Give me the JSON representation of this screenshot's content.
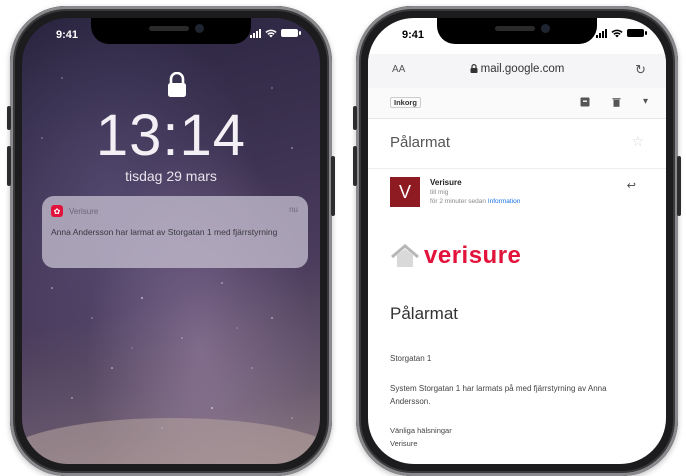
{
  "lock_phone": {
    "status_time": "9:41",
    "clock": "13:14",
    "date": "tisdag 29 mars",
    "notification": {
      "app_name": "Verisure",
      "time": "nu",
      "body": "Anna Andersson har larmat av Storgatan 1 med fjärrstyrning"
    }
  },
  "mail_phone": {
    "status_time": "9:41",
    "browser": {
      "text_size_label": "AA",
      "url": "mail.google.com"
    },
    "toolbar": {
      "label": "Inkorg"
    },
    "subject": "Pålarmat",
    "sender": {
      "avatar_letter": "V",
      "name": "Verisure",
      "to": "till mig",
      "time_prefix": "för 2 minuter sedan",
      "details_link": "Information"
    },
    "logo_text": "verisure",
    "body": {
      "heading": "Pålarmat",
      "location": "Storgatan 1",
      "message": "System Storgatan 1 har larmats på med fjärrstyrning av Anna Andersson.",
      "greeting": "Vänliga hälsningar",
      "signature": "Verisure"
    }
  },
  "colors": {
    "brand_red": "#e2143c",
    "avatar_bg": "#8e1a22"
  }
}
